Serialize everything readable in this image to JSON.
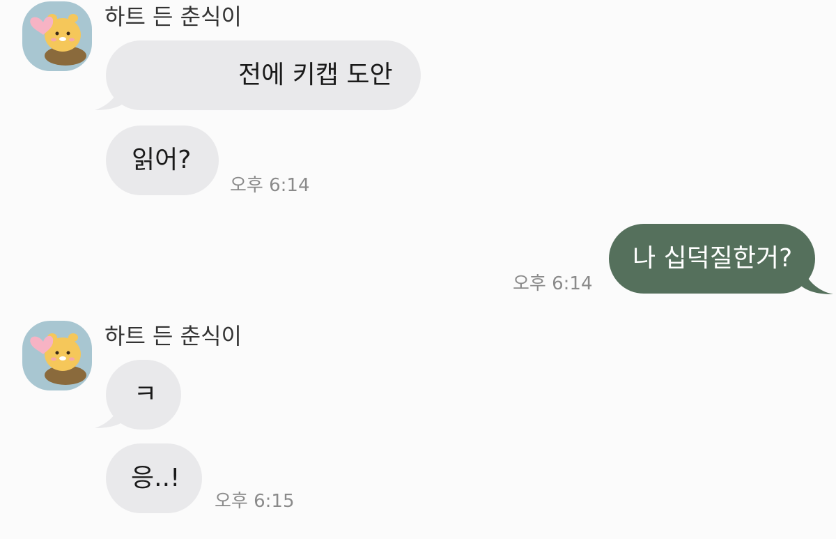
{
  "colors": {
    "background": "#fbfbfb",
    "incoming_bubble": "#e9e9eb",
    "outgoing_bubble": "#55705c",
    "avatar_background": "#a8c6d1",
    "timestamp": "#8a8a8a"
  },
  "chat": {
    "group1": {
      "sender": "하트 든 춘식이",
      "avatar_icon": "choonsik-holding-heart-icon",
      "messages": [
        {
          "text": "전에 키캡 도안"
        },
        {
          "text": "읽어?",
          "time": "오후 6:14"
        }
      ]
    },
    "outgoing": {
      "text": "나 십덕질한거?",
      "time": "오후 6:14"
    },
    "group2": {
      "sender": "하트 든 춘식이",
      "avatar_icon": "choonsik-holding-heart-icon",
      "messages": [
        {
          "text": "ㅋ"
        },
        {
          "text": "응..!",
          "time": "오후 6:15"
        }
      ]
    }
  }
}
